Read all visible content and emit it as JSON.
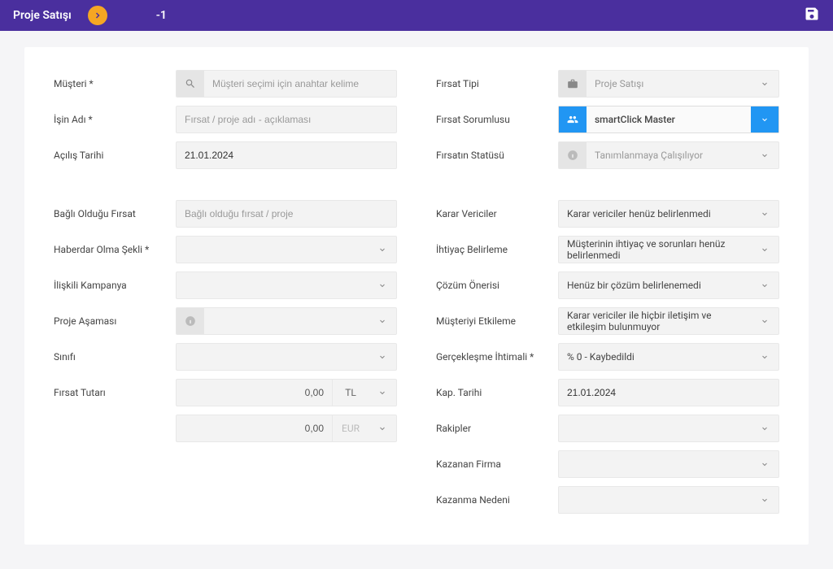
{
  "header": {
    "title": "Proje Satışı",
    "id": "-1"
  },
  "left": {
    "musteri": {
      "label": "Müşteri *",
      "placeholder": "Müşteri seçimi için anahtar kelime"
    },
    "isin_adi": {
      "label": "İşin Adı *",
      "placeholder": "Fırsat / proje adı - açıklaması"
    },
    "acilis_tarihi": {
      "label": "Açılış Tarihi",
      "value": "21.01.2024"
    },
    "bagli_firsat": {
      "label": "Bağlı Olduğu Fırsat",
      "placeholder": "Bağlı olduğu fırsat / proje"
    },
    "haberdar": {
      "label": "Haberdar Olma Şekli *"
    },
    "kampanya": {
      "label": "İlişkili Kampanya"
    },
    "asama": {
      "label": "Proje Aşaması"
    },
    "sinifi": {
      "label": "Sınıfı"
    },
    "tutar": {
      "label": "Fırsat Tutarı",
      "amount1": "0,00",
      "cur1": "TL",
      "amount2": "0,00",
      "cur2": "EUR"
    }
  },
  "right": {
    "tip": {
      "label": "Fırsat Tipi",
      "value": "Proje Satışı"
    },
    "sorumlu": {
      "label": "Fırsat Sorumlusu",
      "value": "smartClick Master"
    },
    "statu": {
      "label": "Fırsatın Statüsü",
      "value": "Tanımlanmaya Çalışılıyor"
    },
    "karar": {
      "label": "Karar Vericiler",
      "value": "Karar vericiler henüz belirlenmedi"
    },
    "ihtiyac": {
      "label": "İhtiyaç Belirleme",
      "value": "Müşterinin ihtiyaç ve sorunları henüz belirlenmedi"
    },
    "cozum": {
      "label": "Çözüm Önerisi",
      "value": "Henüz bir çözüm belirlenemedi"
    },
    "etkileme": {
      "label": "Müşteriyi Etkileme",
      "value": "Karar vericiler ile hiçbir iletişim ve etkileşim bulunmuyor"
    },
    "ihtimal": {
      "label": "Gerçekleşme İhtimali *",
      "value": "% 0 - Kaybedildi"
    },
    "kap_tarihi": {
      "label": "Kap. Tarihi",
      "value": "21.01.2024"
    },
    "rakipler": {
      "label": "Rakipler"
    },
    "kazanan": {
      "label": "Kazanan Firma"
    },
    "neden": {
      "label": "Kazanma Nedeni"
    }
  }
}
